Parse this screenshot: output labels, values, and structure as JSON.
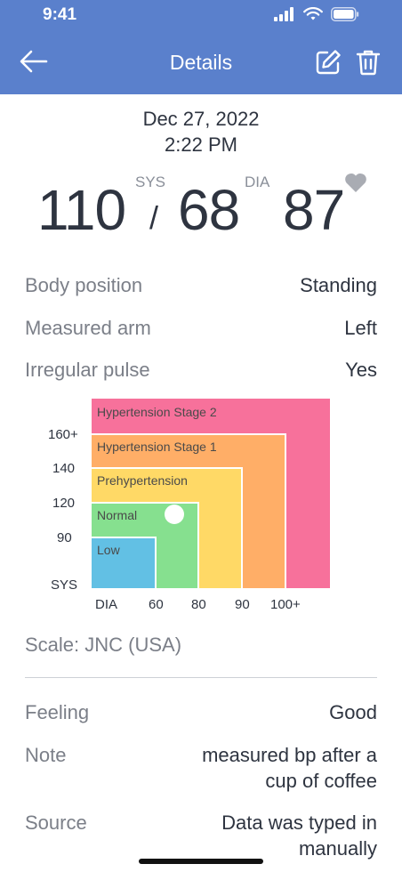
{
  "status": {
    "time": "9:41"
  },
  "nav": {
    "title": "Details"
  },
  "measurement": {
    "date": "Dec 27, 2022",
    "time": "2:22 PM",
    "sys": "110",
    "dia": "68",
    "pulse": "87",
    "sys_label": "SYS",
    "dia_label": "DIA",
    "slash": "/"
  },
  "details": [
    {
      "label": "Body position",
      "value": "Standing"
    },
    {
      "label": "Measured arm",
      "value": "Left"
    },
    {
      "label": "Irregular pulse",
      "value": "Yes"
    }
  ],
  "chart": {
    "zones": [
      {
        "label": "Hypertension Stage 2",
        "color": "#f7719b"
      },
      {
        "label": "Hypertension Stage 1",
        "color": "#ffae67"
      },
      {
        "label": "Prehypertension",
        "color": "#ffd966"
      },
      {
        "label": "Normal",
        "color": "#86e08f"
      },
      {
        "label": "Low",
        "color": "#62c0e4"
      }
    ],
    "y_ticks": [
      "160+",
      "140",
      "120",
      "90"
    ],
    "y_label": "SYS",
    "x_label": "DIA",
    "x_ticks": [
      "60",
      "80",
      "90",
      "100+"
    ],
    "marker_color": "#ffffff"
  },
  "scale": "Scale: JNC (USA)",
  "extra": [
    {
      "label": "Feeling",
      "value": "Good"
    },
    {
      "label": "Note",
      "value_line1": "measured bp after a",
      "value_line2": "cup of coffee"
    },
    {
      "label": "Source",
      "value_line1": "Data was typed in",
      "value_line2": "manually"
    }
  ]
}
